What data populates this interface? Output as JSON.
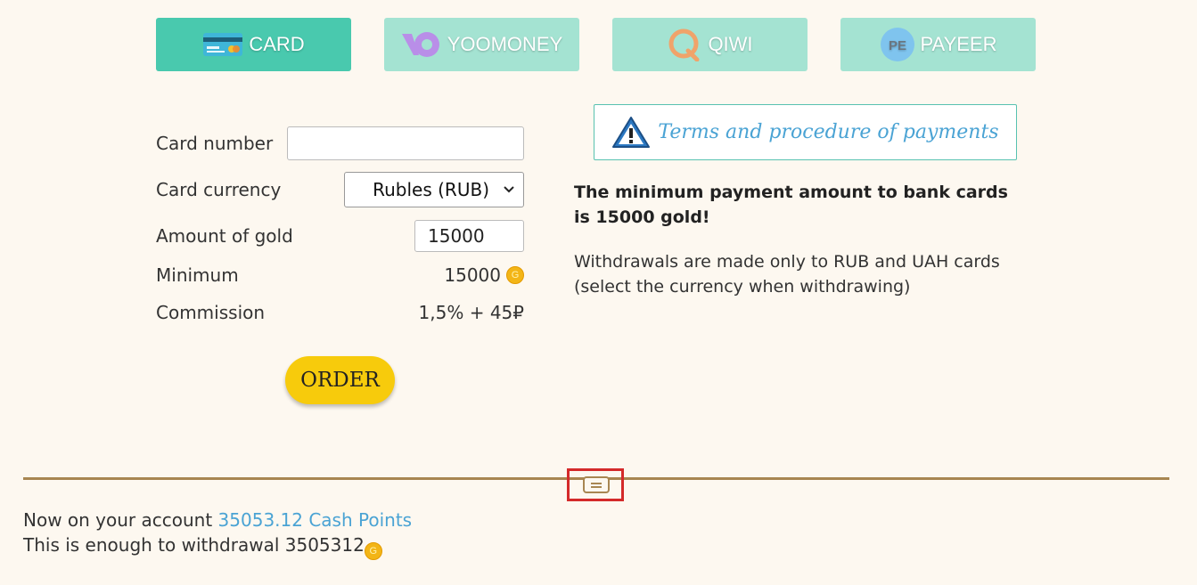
{
  "tabs": [
    {
      "label": "CARD",
      "icon": "credit-card-icon",
      "active": true
    },
    {
      "label": "YOOMONEY",
      "icon": "yoomoney-logo-icon",
      "active": false
    },
    {
      "label": "QIWI",
      "icon": "qiwi-logo-icon",
      "active": false
    },
    {
      "label": "PAYEER",
      "icon": "payeer-logo-icon",
      "icon_text": "PE",
      "active": false
    }
  ],
  "form": {
    "card_number_label": "Card number",
    "card_number_value": "",
    "card_currency_label": "Card currency",
    "card_currency_value": "Rubles (RUB)",
    "amount_label": "Amount of gold",
    "amount_value": "15000",
    "minimum_label": "Minimum",
    "minimum_value": "15000",
    "commission_label": "Commission",
    "commission_value": "1,5% + 45₽",
    "order_label": "ORDER"
  },
  "info": {
    "terms_label": "Terms and procedure of payments",
    "bold_text": "The minimum payment amount to bank cards is 15000 gold!",
    "note_text": "Withdrawals are made only to RUB and UAH cards (select the currency when withdrawing)"
  },
  "account": {
    "prefix": "Now on your account ",
    "balance": "35053.12 Cash Points",
    "enough_prefix": "This is enough to withdrawal ",
    "enough_value": "3505312",
    "coin_glyph": "G"
  },
  "colors": {
    "tab_active": "#49c9ae",
    "tab_inactive": "#a4e3d2",
    "order_button": "#f7cb0c",
    "link": "#4aa3d4",
    "divider": "#a88651",
    "highlight": "#d42a2a",
    "background": "#fdf8f0"
  }
}
